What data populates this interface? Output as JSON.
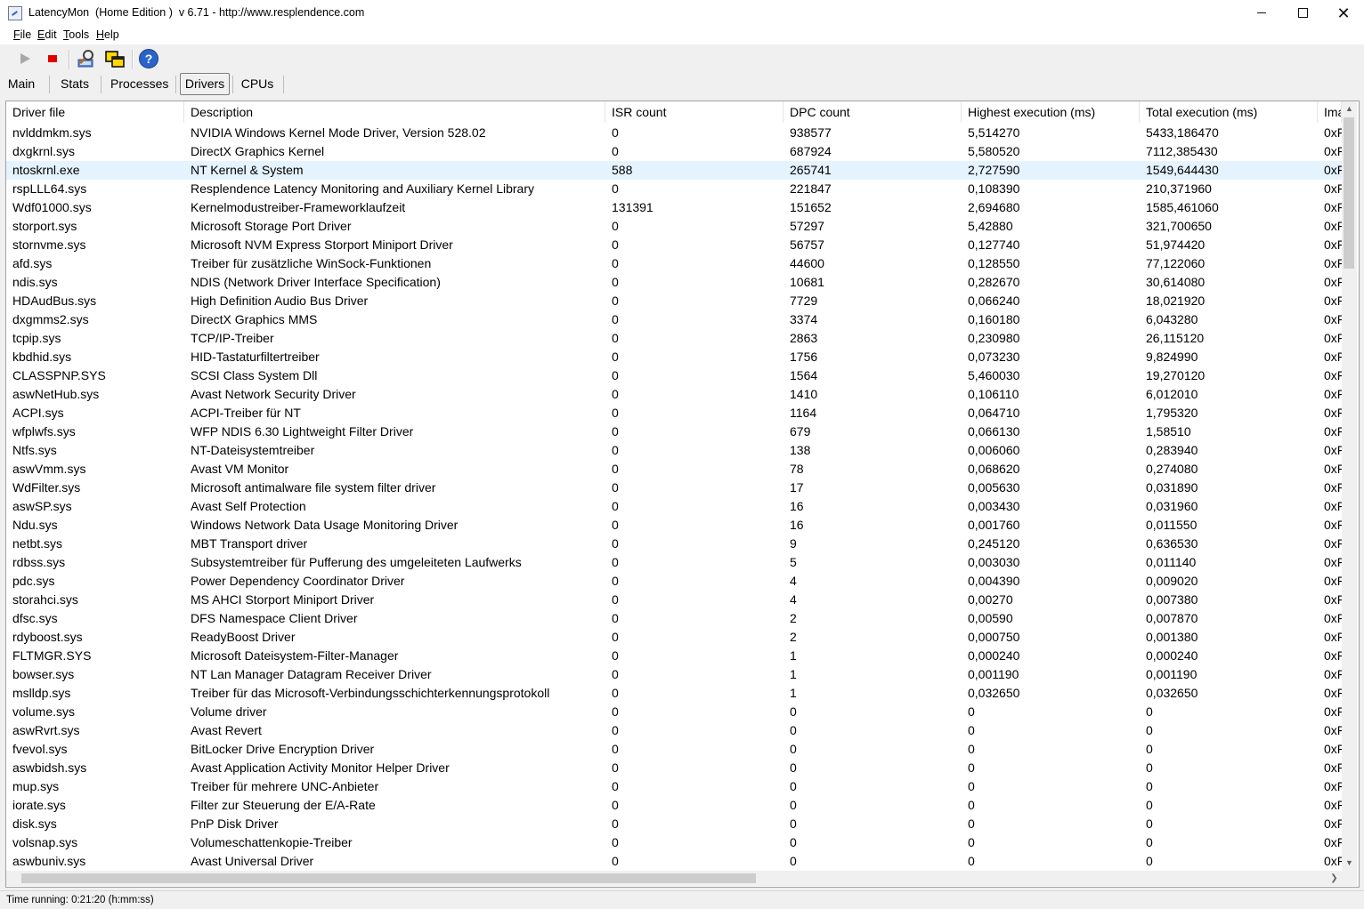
{
  "window": {
    "title": "LatencyMon  (Home Edition )  v 6.71 - http://www.resplendence.com",
    "min_label": "",
    "close_label": "✕"
  },
  "menu": [
    {
      "label": "File",
      "underline": "F"
    },
    {
      "label": "Edit",
      "underline": "E"
    },
    {
      "label": "Tools",
      "underline": "T"
    },
    {
      "label": "Help",
      "underline": "H"
    }
  ],
  "toolbar": {
    "icons": [
      "play-icon",
      "stop-icon",
      "analyze-icon",
      "windows-icon",
      "help-icon"
    ],
    "help_glyph": "?"
  },
  "tabs": [
    {
      "label": "Main"
    },
    {
      "label": "Stats"
    },
    {
      "label": "Processes"
    },
    {
      "label": "Drivers",
      "active": true
    },
    {
      "label": "CPUs"
    }
  ],
  "table": {
    "columns": [
      "Driver file",
      "Description",
      "ISR count",
      "DPC count",
      "Highest execution (ms)",
      "Total execution (ms)",
      "Ima"
    ],
    "selected_row": 2,
    "rows": [
      [
        "nvlddmkm.sys",
        "NVIDIA Windows Kernel Mode Driver, Version 528.02",
        "0",
        "938577",
        "5,514270",
        "5433,186470",
        "0xF"
      ],
      [
        "dxgkrnl.sys",
        "DirectX Graphics Kernel",
        "0",
        "687924",
        "5,580520",
        "7112,385430",
        "0xF"
      ],
      [
        "ntoskrnl.exe",
        "NT Kernel & System",
        "588",
        "265741",
        "2,727590",
        "1549,644430",
        "0xF"
      ],
      [
        "rspLLL64.sys",
        "Resplendence Latency Monitoring and Auxiliary Kernel Library",
        "0",
        "221847",
        "0,108390",
        "210,371960",
        "0xF"
      ],
      [
        "Wdf01000.sys",
        "Kernelmodustreiber-Frameworklaufzeit",
        "131391",
        "151652",
        "2,694680",
        "1585,461060",
        "0xF"
      ],
      [
        "storport.sys",
        "Microsoft Storage Port Driver",
        "0",
        "57297",
        "5,42880",
        "321,700650",
        "0xF"
      ],
      [
        "stornvme.sys",
        "Microsoft NVM Express Storport Miniport Driver",
        "0",
        "56757",
        "0,127740",
        "51,974420",
        "0xF"
      ],
      [
        "afd.sys",
        "Treiber für zusätzliche WinSock-Funktionen",
        "0",
        "44600",
        "0,128550",
        "77,122060",
        "0xF"
      ],
      [
        "ndis.sys",
        "NDIS (Network Driver Interface Specification)",
        "0",
        "10681",
        "0,282670",
        "30,614080",
        "0xF"
      ],
      [
        "HDAudBus.sys",
        "High Definition Audio Bus Driver",
        "0",
        "7729",
        "0,066240",
        "18,021920",
        "0xF"
      ],
      [
        "dxgmms2.sys",
        "DirectX Graphics MMS",
        "0",
        "3374",
        "0,160180",
        "6,043280",
        "0xF"
      ],
      [
        "tcpip.sys",
        "TCP/IP-Treiber",
        "0",
        "2863",
        "0,230980",
        "26,115120",
        "0xF"
      ],
      [
        "kbdhid.sys",
        "HID-Tastaturfiltertreiber",
        "0",
        "1756",
        "0,073230",
        "9,824990",
        "0xF"
      ],
      [
        "CLASSPNP.SYS",
        "SCSI Class System Dll",
        "0",
        "1564",
        "5,460030",
        "19,270120",
        "0xF"
      ],
      [
        "aswNetHub.sys",
        "Avast Network Security Driver",
        "0",
        "1410",
        "0,106110",
        "6,012010",
        "0xF"
      ],
      [
        "ACPI.sys",
        "ACPI-Treiber für NT",
        "0",
        "1164",
        "0,064710",
        "1,795320",
        "0xF"
      ],
      [
        "wfplwfs.sys",
        "WFP NDIS 6.30 Lightweight Filter Driver",
        "0",
        "679",
        "0,066130",
        "1,58510",
        "0xF"
      ],
      [
        "Ntfs.sys",
        "NT-Dateisystemtreiber",
        "0",
        "138",
        "0,006060",
        "0,283940",
        "0xF"
      ],
      [
        "aswVmm.sys",
        "Avast VM Monitor",
        "0",
        "78",
        "0,068620",
        "0,274080",
        "0xF"
      ],
      [
        "WdFilter.sys",
        "Microsoft antimalware file system filter driver",
        "0",
        "17",
        "0,005630",
        "0,031890",
        "0xF"
      ],
      [
        "aswSP.sys",
        "Avast Self Protection",
        "0",
        "16",
        "0,003430",
        "0,031960",
        "0xF"
      ],
      [
        "Ndu.sys",
        "Windows Network Data Usage Monitoring Driver",
        "0",
        "16",
        "0,001760",
        "0,011550",
        "0xF"
      ],
      [
        "netbt.sys",
        "MBT Transport driver",
        "0",
        "9",
        "0,245120",
        "0,636530",
        "0xF"
      ],
      [
        "rdbss.sys",
        "Subsystemtreiber für Pufferung des umgeleiteten Laufwerks",
        "0",
        "5",
        "0,003030",
        "0,011140",
        "0xF"
      ],
      [
        "pdc.sys",
        "Power Dependency Coordinator Driver",
        "0",
        "4",
        "0,004390",
        "0,009020",
        "0xF"
      ],
      [
        "storahci.sys",
        "MS AHCI Storport Miniport Driver",
        "0",
        "4",
        "0,00270",
        "0,007380",
        "0xF"
      ],
      [
        "dfsc.sys",
        "DFS Namespace Client Driver",
        "0",
        "2",
        "0,00590",
        "0,007870",
        "0xF"
      ],
      [
        "rdyboost.sys",
        "ReadyBoost Driver",
        "0",
        "2",
        "0,000750",
        "0,001380",
        "0xF"
      ],
      [
        "FLTMGR.SYS",
        "Microsoft Dateisystem-Filter-Manager",
        "0",
        "1",
        "0,000240",
        "0,000240",
        "0xF"
      ],
      [
        "bowser.sys",
        "NT Lan Manager Datagram Receiver Driver",
        "0",
        "1",
        "0,001190",
        "0,001190",
        "0xF"
      ],
      [
        "mslldp.sys",
        "Treiber für das Microsoft-Verbindungsschichterkennungsprotokoll",
        "0",
        "1",
        "0,032650",
        "0,032650",
        "0xF"
      ],
      [
        "volume.sys",
        "Volume driver",
        "0",
        "0",
        "0",
        "0",
        "0xF"
      ],
      [
        "aswRvrt.sys",
        "Avast Revert",
        "0",
        "0",
        "0",
        "0",
        "0xF"
      ],
      [
        "fvevol.sys",
        "BitLocker Drive Encryption Driver",
        "0",
        "0",
        "0",
        "0",
        "0xF"
      ],
      [
        "aswbidsh.sys",
        "Avast Application Activity Monitor Helper Driver",
        "0",
        "0",
        "0",
        "0",
        "0xF"
      ],
      [
        "mup.sys",
        "Treiber für mehrere UNC-Anbieter",
        "0",
        "0",
        "0",
        "0",
        "0xF"
      ],
      [
        "iorate.sys",
        "Filter zur Steuerung der E/A-Rate",
        "0",
        "0",
        "0",
        "0",
        "0xF"
      ],
      [
        "disk.sys",
        "PnP Disk Driver",
        "0",
        "0",
        "0",
        "0",
        "0xF"
      ],
      [
        "volsnap.sys",
        "Volumeschattenkopie-Treiber",
        "0",
        "0",
        "0",
        "0",
        "0xF"
      ],
      [
        "aswbuniv.sys",
        "Avast Universal Driver",
        "0",
        "0",
        "0",
        "0",
        "0xF"
      ]
    ]
  },
  "status": {
    "text": "Time running: 0:21:20  (h:mm:ss)"
  },
  "colors": {
    "selected_row_bg": "#e5f3ff",
    "stop_red": "#e00000",
    "help_blue": "#2a64c8"
  }
}
